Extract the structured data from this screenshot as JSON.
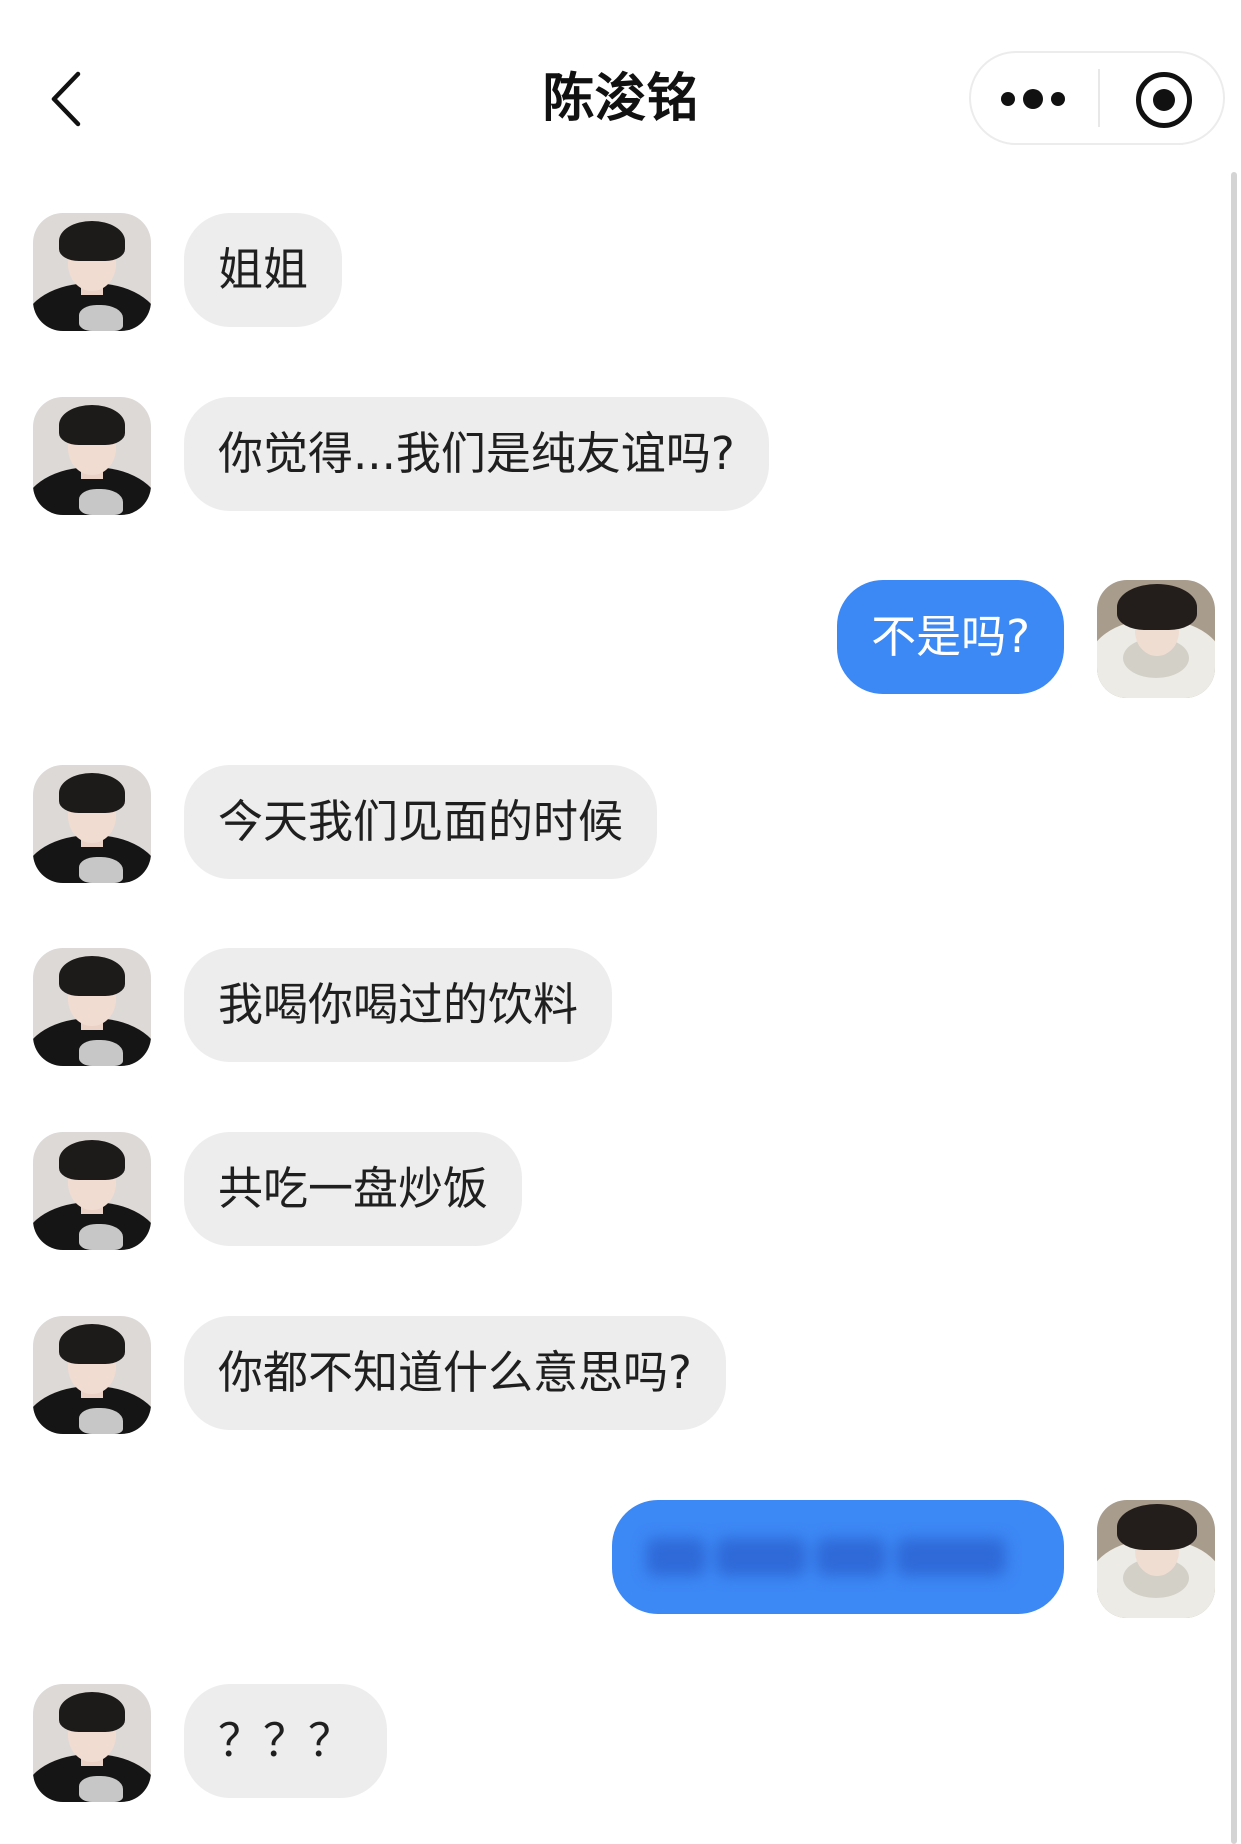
{
  "header": {
    "title": "陈浚铭",
    "back_icon": "chevron-left-icon",
    "more_icon": "more-dots-icon",
    "close_icon": "target-icon"
  },
  "colors": {
    "incoming_bubble": "#ededed",
    "outgoing_bubble": "#3c88f5",
    "outgoing_text": "#ffffff"
  },
  "messages": [
    {
      "sender": "contact",
      "text": "姐姐"
    },
    {
      "sender": "contact",
      "text": "你觉得...我们是纯友谊吗?"
    },
    {
      "sender": "user",
      "text": "不是吗?"
    },
    {
      "sender": "contact",
      "text": "今天我们见面的时候"
    },
    {
      "sender": "contact",
      "text": "我喝你喝过的饮料"
    },
    {
      "sender": "contact",
      "text": "共吃一盘炒饭"
    },
    {
      "sender": "contact",
      "text": "你都不知道什么意思吗?"
    },
    {
      "sender": "user",
      "text": "",
      "blurred": true
    },
    {
      "sender": "contact",
      "text": "？？？"
    }
  ]
}
